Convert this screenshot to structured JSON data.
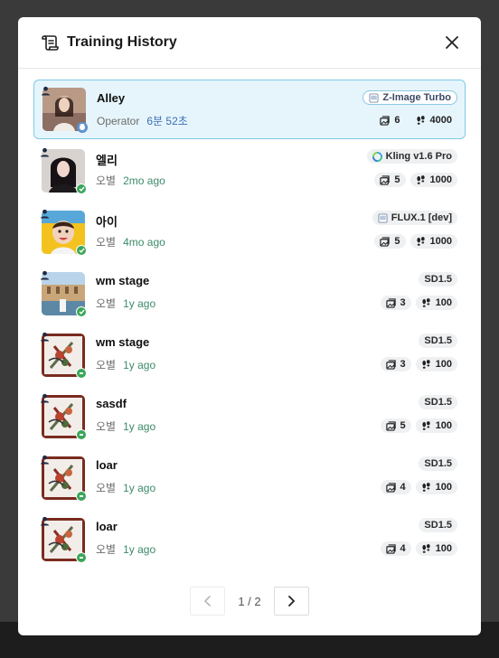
{
  "dialog": {
    "title": "Training History"
  },
  "items": [
    {
      "name": "Alley",
      "user": "Operator",
      "time": "6분 52초",
      "model": "Z-Image Turbo",
      "images": "6",
      "steps": "4000",
      "status": "training"
    },
    {
      "name": "엘리",
      "user": "오별",
      "time": "2mo ago",
      "model": "Kling v1.6 Pro",
      "images": "5",
      "steps": "1000",
      "status": "done"
    },
    {
      "name": "아이",
      "user": "오별",
      "time": "4mo ago",
      "model": "FLUX.1 [dev]",
      "images": "5",
      "steps": "1000",
      "status": "done"
    },
    {
      "name": "wm stage",
      "user": "오별",
      "time": "1y ago",
      "model": "SD1.5",
      "images": "3",
      "steps": "100",
      "status": "done"
    },
    {
      "name": "wm stage",
      "user": "오별",
      "time": "1y ago",
      "model": "SD1.5",
      "images": "3",
      "steps": "100",
      "status": "partial"
    },
    {
      "name": "sasdf",
      "user": "오별",
      "time": "1y ago",
      "model": "SD1.5",
      "images": "5",
      "steps": "100",
      "status": "partial"
    },
    {
      "name": "loar",
      "user": "오별",
      "time": "1y ago",
      "model": "SD1.5",
      "images": "4",
      "steps": "100",
      "status": "partial"
    },
    {
      "name": "loar",
      "user": "오별",
      "time": "1y ago",
      "model": "SD1.5",
      "images": "4",
      "steps": "100",
      "status": "partial"
    }
  ],
  "pagination": {
    "text": "1 / 2",
    "prev_icon": "chevron-left-icon",
    "next_icon": "chevron-right-icon"
  },
  "colors": {
    "selected_bg": "#e6f5fc",
    "selected_border": "#7dcbe8",
    "time_green": "#3c8a68",
    "status_green": "#3aa65a"
  },
  "icons": {
    "header": "scroll-history-icon",
    "close": "close-icon",
    "images": "image-icon",
    "steps": "footsteps-icon",
    "user": "user-icon"
  }
}
